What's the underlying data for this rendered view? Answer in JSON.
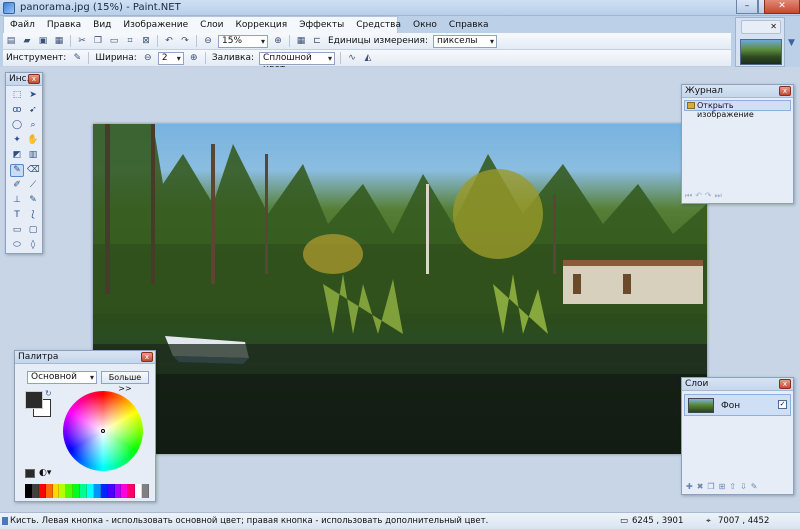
{
  "window": {
    "title": "panorama.jpg (15%) - Paint.NET"
  },
  "menu": [
    "Файл",
    "Правка",
    "Вид",
    "Изображение",
    "Слои",
    "Коррекция",
    "Эффекты",
    "Средства",
    "Окно",
    "Справка"
  ],
  "toolbar": {
    "zoom": "15%",
    "units_label": "Единицы измерения:",
    "units_value": "пикселы"
  },
  "toolbar2": {
    "tool_label": "Инструмент:",
    "width_label": "Ширина:",
    "width_value": "2",
    "fill_label": "Заливка:",
    "fill_value": "Сплошной цвет"
  },
  "tools_panel": {
    "title": "Инс..."
  },
  "history_panel": {
    "title": "Журнал",
    "items": [
      "Открыть изображение"
    ]
  },
  "palette_panel": {
    "title": "Палитра",
    "mode": "Основной",
    "more_button": "Больше >>",
    "colors": [
      "#000000",
      "#404040",
      "#ff0000",
      "#ff6a00",
      "#ffd800",
      "#b6ff00",
      "#4cff00",
      "#00ff21",
      "#00ff90",
      "#00ffff",
      "#0094ff",
      "#0026ff",
      "#4800ff",
      "#b200ff",
      "#ff00dc",
      "#ff006e",
      "#ffffff",
      "#808080"
    ]
  },
  "layers_panel": {
    "title": "Слои",
    "layer_name": "Фон"
  },
  "status": {
    "hint": "Кисть. Левая кнопка - использовать основной цвет; правая кнопка - использовать дополнительный цвет.",
    "size": "6245 , 3901",
    "pos": "7007 , 4452"
  }
}
